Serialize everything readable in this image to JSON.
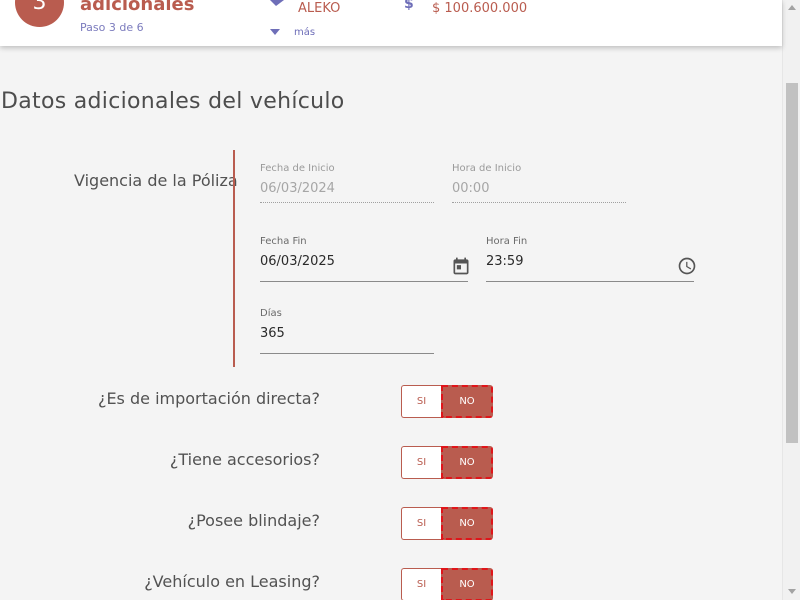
{
  "header": {
    "step_number": "3",
    "step_title": "adicionales",
    "step_subtitle": "Paso 3 de 6",
    "brand_value": "ALEKO",
    "more_label": "más",
    "price_icon": "$",
    "price_value": "$ 100.600.000"
  },
  "main": {
    "section_title": "Datos adicionales del vehículo",
    "vigencia_label": "Vigencia de la Póliza",
    "fields": {
      "fecha_inicio": {
        "label": "Fecha de Inicio",
        "value": "06/03/2024"
      },
      "hora_inicio": {
        "label": "Hora de Inicio",
        "value": "00:00"
      },
      "fecha_fin": {
        "label": "Fecha Fin",
        "value": "06/03/2025",
        "icon": "calendar-icon"
      },
      "hora_fin": {
        "label": "Hora Fin",
        "value": "23:59",
        "icon": "clock-icon"
      },
      "dias": {
        "label": "Días",
        "value": "365"
      }
    },
    "questions": [
      {
        "label": "¿Es de importación directa?",
        "yes": "SI",
        "no": "NO",
        "selected": "NO"
      },
      {
        "label": "¿Tiene accesorios?",
        "yes": "SI",
        "no": "NO",
        "selected": "NO"
      },
      {
        "label": "¿Posee blindaje?",
        "yes": "SI",
        "no": "NO",
        "selected": "NO"
      },
      {
        "label": "¿Vehículo en Leasing?",
        "yes": "SI",
        "no": "NO",
        "selected": "NO"
      }
    ]
  },
  "colors": {
    "accent": "#b95c4f",
    "link": "#6e6eb8",
    "focus_outline": "#e0151a",
    "background": "#f4f4f4"
  }
}
